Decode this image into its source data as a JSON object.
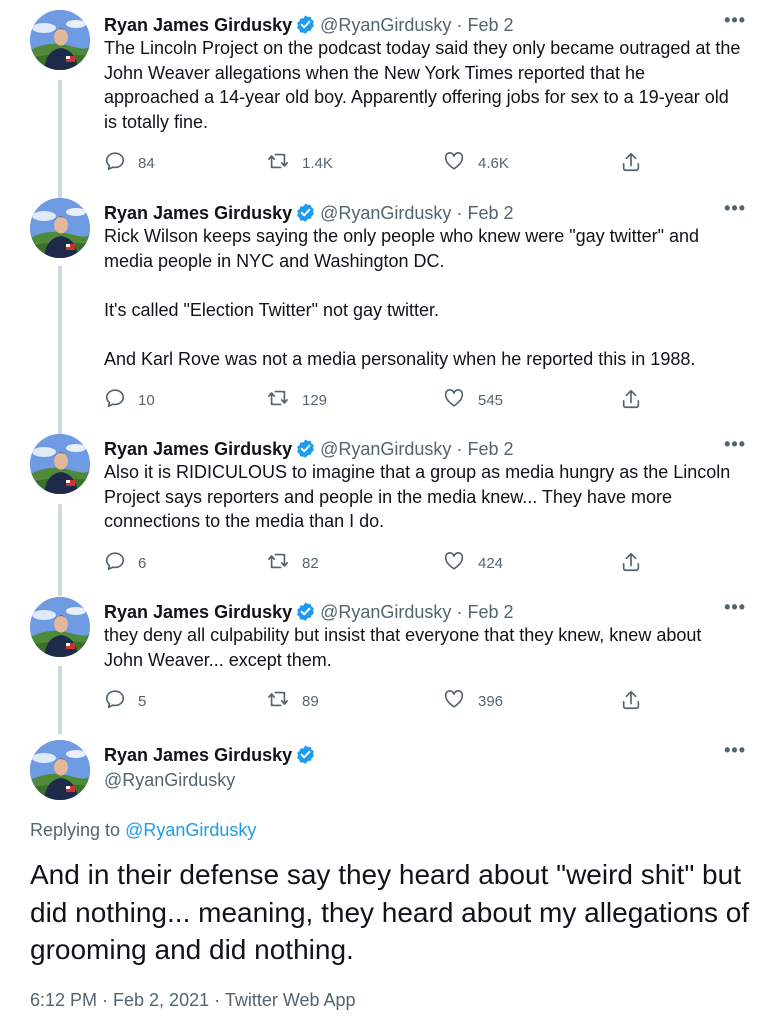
{
  "author": {
    "name": "Ryan James Girdusky",
    "handle": "@RyanGirdusky"
  },
  "ui": {
    "more_icon": "more-horizontal-icon",
    "verified_icon": "verified-badge-icon",
    "separator": "·"
  },
  "colors": {
    "text": "#0f1419",
    "muted": "#536471",
    "accent": "#1d9bf0",
    "thread_line": "#cfd9de"
  },
  "tweets": [
    {
      "date": "Feb 2",
      "paragraphs": [
        "The Lincoln Project on the podcast today said they only became outraged at the John Weaver allegations when the New York Times reported that he approached a 14-year old boy. Apparently offering jobs for sex to a 19-year old is totally fine."
      ],
      "replies": "84",
      "retweets": "1.4K",
      "likes": "4.6K"
    },
    {
      "date": "Feb 2",
      "paragraphs": [
        "Rick Wilson keeps saying the only people who knew were \"gay twitter\" and media people in NYC and Washington DC.",
        "It's called \"Election Twitter\" not gay twitter.",
        "And Karl Rove was not a media personality when he reported this in 1988."
      ],
      "replies": "10",
      "retweets": "129",
      "likes": "545"
    },
    {
      "date": "Feb 2",
      "paragraphs": [
        "Also it is RIDICULOUS to imagine that a group as media hungry as the Lincoln Project says reporters and people in the media knew... They have more connections to the media than I do."
      ],
      "replies": "6",
      "retweets": "82",
      "likes": "424"
    },
    {
      "date": "Feb 2",
      "paragraphs": [
        "they deny all culpability but insist that everyone that they knew, knew about John Weaver... except them."
      ],
      "replies": "5",
      "retweets": "89",
      "likes": "396"
    }
  ],
  "main_tweet": {
    "replying_prefix": "Replying to",
    "replying_to": "@RyanGirdusky",
    "text": "And in their defense say they heard about \"weird shit\" but did nothing... meaning, they heard about my allegations of grooming and did nothing.",
    "timestamp": "6:12 PM · Feb 2, 2021",
    "source": "Twitter Web App"
  }
}
